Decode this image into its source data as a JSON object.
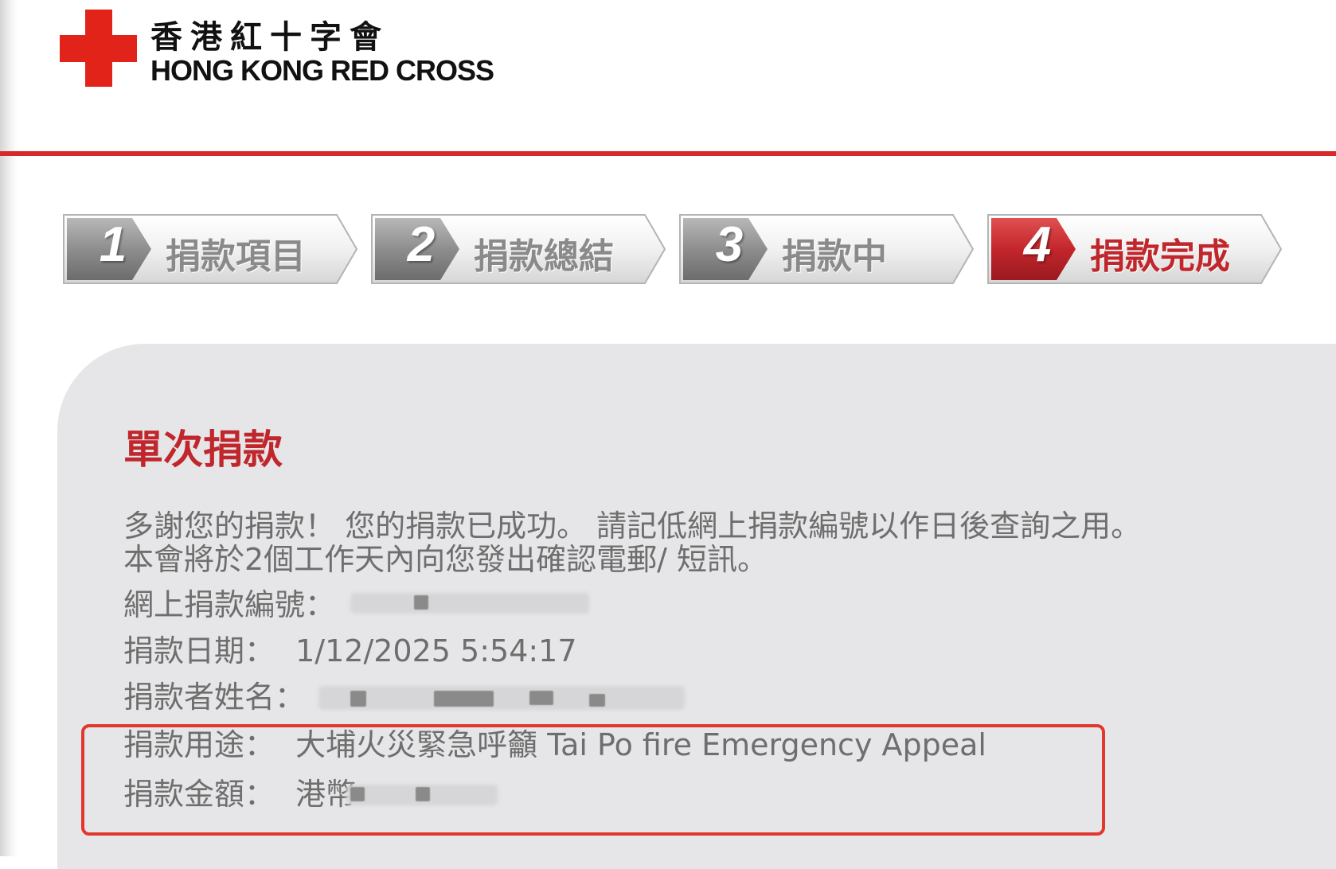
{
  "header": {
    "logo_zh": "香港紅十字會",
    "logo_en": "HONG KONG RED CROSS"
  },
  "steps": [
    {
      "number": "1",
      "label": "捐款項目",
      "active": false
    },
    {
      "number": "2",
      "label": "捐款總結",
      "active": false
    },
    {
      "number": "3",
      "label": "捐款中",
      "active": false
    },
    {
      "number": "4",
      "label": "捐款完成",
      "active": true
    }
  ],
  "result": {
    "title": "單次捐款",
    "message_line1": "多謝您的捐款！ 您的捐款已成功。 請記低網上捐款編號以作日後查詢之用。",
    "message_line2": "本會將於2個工作天內向您發出確認電郵/ 短訊。",
    "ref_label": "網上捐款編號：",
    "ref_value": "",
    "date_label": "捐款日期：",
    "date_value": "1/12/2025 5:54:17",
    "name_label": "捐款者姓名：",
    "name_value": "",
    "purpose_label": "捐款用途：",
    "purpose_value": "大埔火災緊急呼籲 Tai Po fire Emergency Appeal",
    "amount_label": "捐款金額：",
    "amount_value": "港幣"
  },
  "colors": {
    "brand_red": "#e2231a",
    "title_red": "#c0272d",
    "panel_gray": "#e6e6e8",
    "highlight_red": "#e2372d"
  }
}
